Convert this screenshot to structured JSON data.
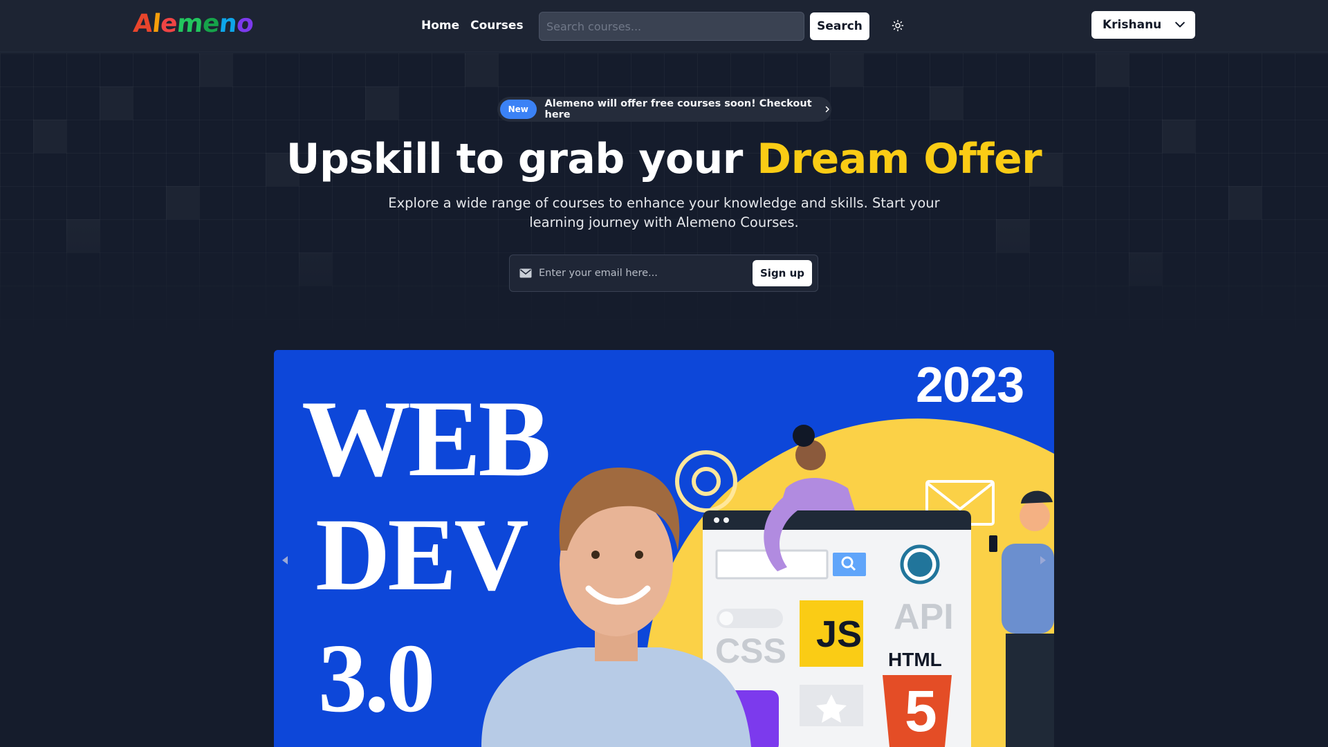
{
  "navbar": {
    "logo_text": "Alemeno",
    "logo_colors": [
      "#e8452c",
      "#f59e0b",
      "#ef4444",
      "#22c55e",
      "#16a34a",
      "#0ea5e9",
      "#7c3aed"
    ],
    "links": [
      {
        "label": "Home"
      },
      {
        "label": "Courses"
      }
    ],
    "search": {
      "placeholder": "Search courses...",
      "value": ""
    },
    "search_button_label": "Search",
    "theme_icon": "sun-icon",
    "user": {
      "name": "Krishanu",
      "icon": "chevron-down-icon"
    }
  },
  "hero": {
    "badge_label": "New",
    "announcement": "Alemeno will offer free courses soon! Checkout here",
    "headline_main": "Upskill to grab your",
    "headline_accent": "Dream Offer",
    "accent_color": "#facc15",
    "subtext": "Explore a wide range of courses to enhance your knowledge and skills. Start your learning journey with Alemeno Courses.",
    "email": {
      "placeholder": "Enter your email here...",
      "value": ""
    },
    "signup_label": "Sign up"
  },
  "banner": {
    "year": "2023",
    "title_lines": [
      "WEB",
      "DEV",
      "3.0"
    ],
    "tech_labels": [
      "API",
      "CSS",
      "JS",
      "HTML",
      "5"
    ]
  }
}
